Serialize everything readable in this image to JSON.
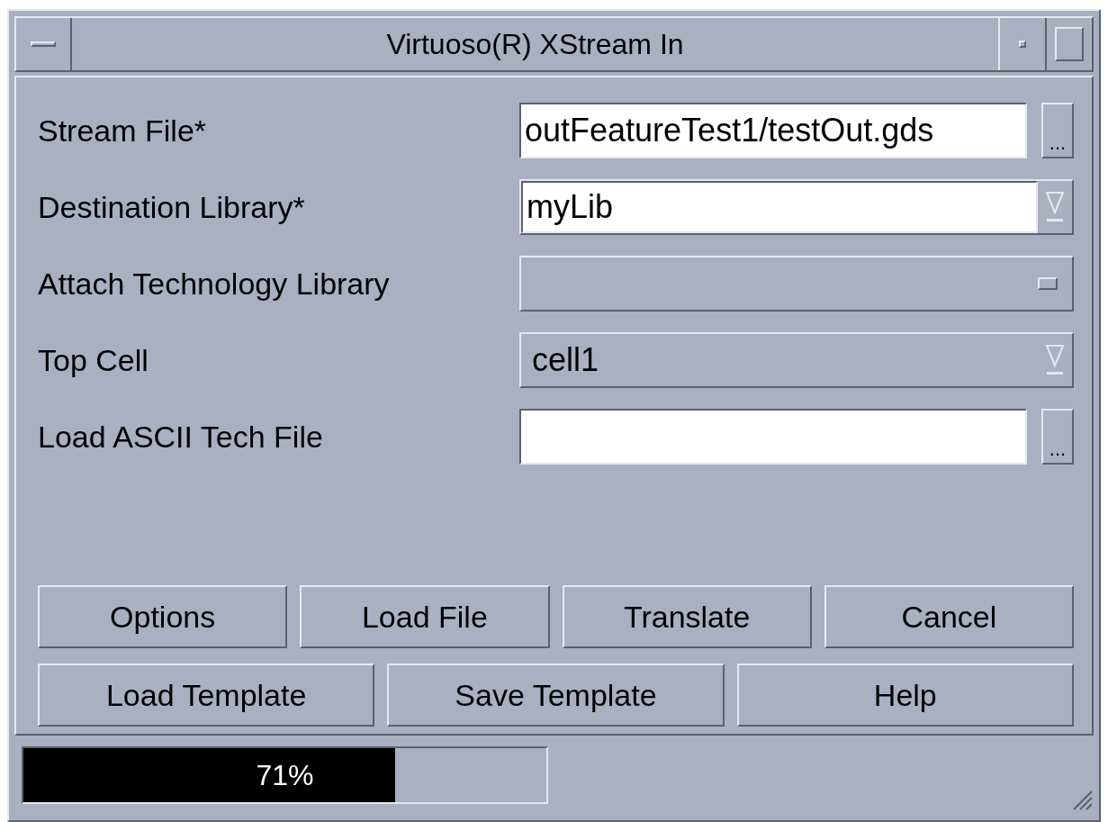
{
  "window": {
    "title": "Virtuoso(R) XStream In"
  },
  "fields": [
    {
      "label": "Stream File*",
      "kind": "file_input",
      "value": "outFeatureTest1/testOut.gds",
      "browse": "..."
    },
    {
      "label": "Destination Library*",
      "kind": "editable_combo",
      "value": "myLib"
    },
    {
      "label": "Attach Technology Library",
      "kind": "option_menu"
    },
    {
      "label": "Top Cell",
      "kind": "combo",
      "value": "cell1"
    },
    {
      "label": "Load ASCII Tech File",
      "kind": "file_input",
      "browse": "..."
    }
  ],
  "button_rows": [
    [
      "Options",
      "Load File",
      "Translate",
      "Cancel"
    ],
    [
      "Load Template",
      "Save Template",
      "Help"
    ]
  ],
  "status_bar": {
    "progress": {
      "level": 0.71,
      "reading": "71%"
    }
  }
}
